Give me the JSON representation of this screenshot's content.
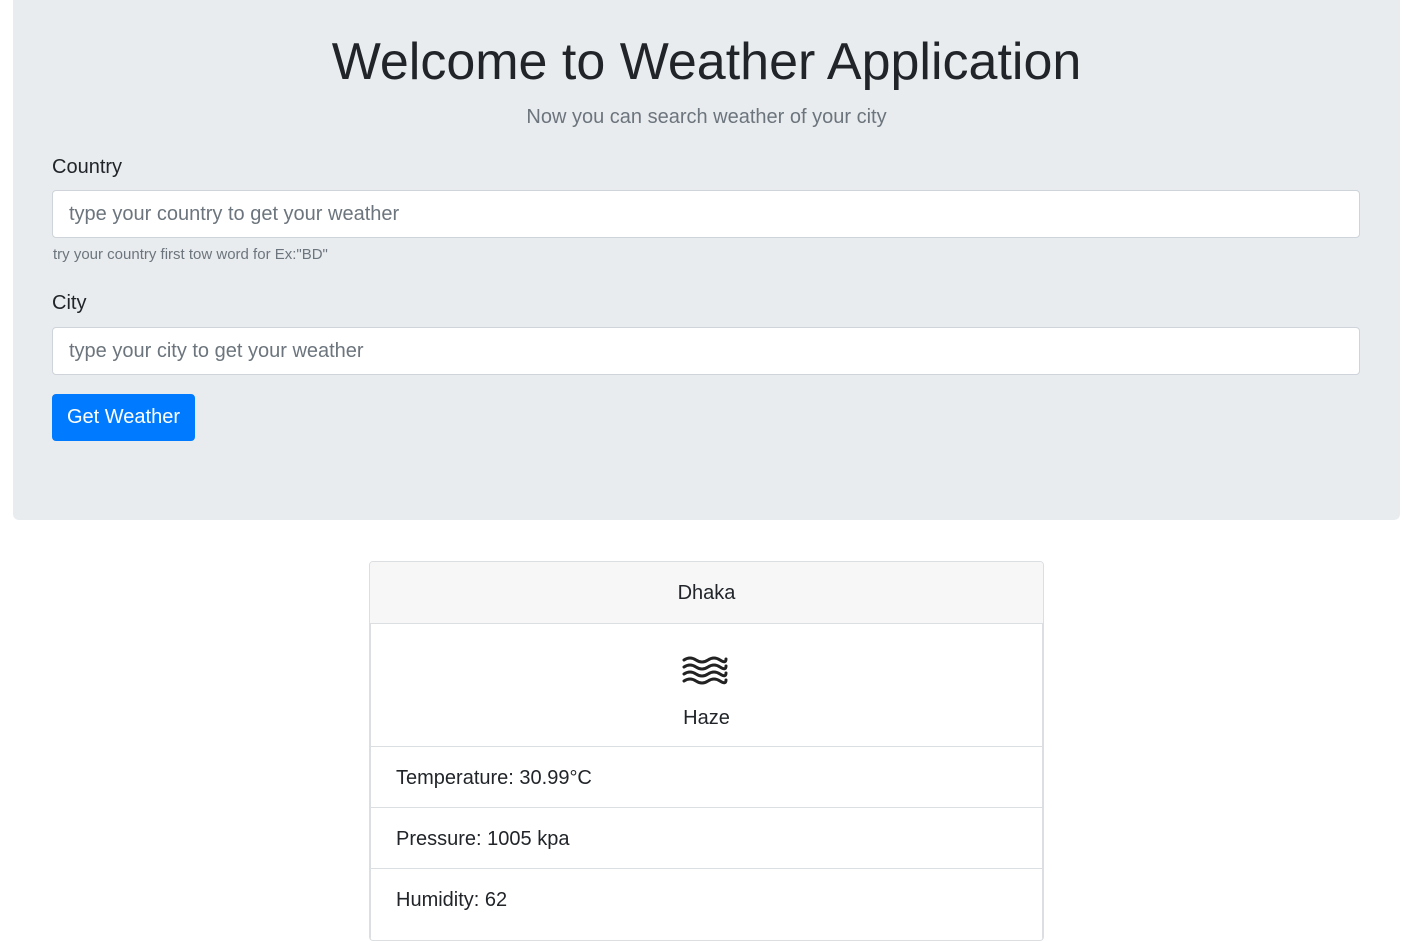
{
  "header": {
    "title": "Welcome to Weather Application",
    "subtitle": "Now you can search weather of your city"
  },
  "form": {
    "country_label": "Country",
    "country_placeholder": "type your country to get your weather",
    "country_value": "",
    "country_help": "try your country first tow word for Ex:\"BD\"",
    "city_label": "City",
    "city_placeholder": "type your city to get your weather",
    "city_value": "",
    "submit_label": "Get Weather"
  },
  "result": {
    "city": "Dhaka",
    "icon": "haze-icon",
    "description": "Haze",
    "details": [
      "Temperature: 30.99°C",
      "Pressure: 1005 kpa",
      "Humidity: 62"
    ]
  },
  "colors": {
    "jumbotron_bg": "#e9ecef",
    "primary": "#007bff",
    "muted": "#6c757d"
  }
}
